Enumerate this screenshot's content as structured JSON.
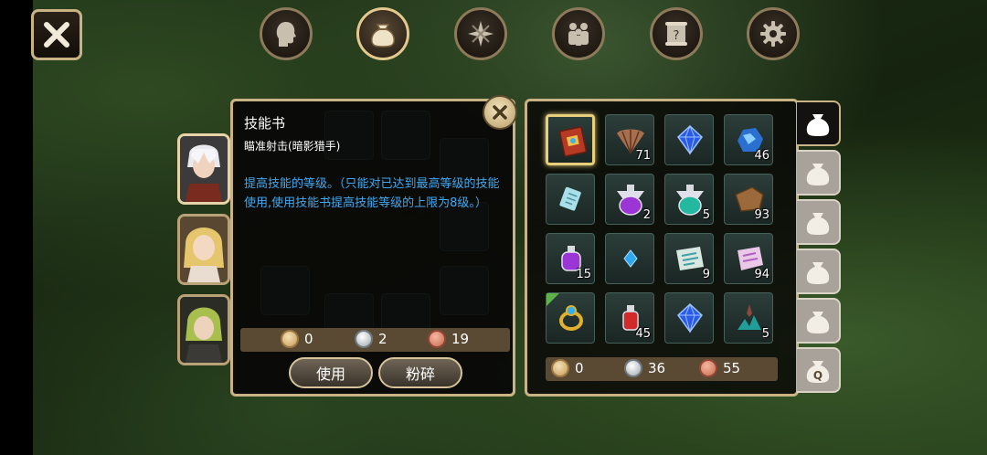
{
  "nav_tabs": [
    {
      "name": "character",
      "icon": "head-icon",
      "active": false
    },
    {
      "name": "bag",
      "icon": "bag-icon",
      "active": true
    },
    {
      "name": "skills",
      "icon": "compass-icon",
      "active": false
    },
    {
      "name": "party",
      "icon": "people-icon",
      "active": false
    },
    {
      "name": "quests",
      "icon": "scroll-icon",
      "active": false
    },
    {
      "name": "settings",
      "icon": "gear-icon",
      "active": false
    }
  ],
  "portraits": [
    {
      "icon": "white-haired-hero-portrait",
      "active": true
    },
    {
      "icon": "blonde-heroine-portrait",
      "active": false
    },
    {
      "icon": "green-haired-hero-portrait",
      "active": false
    }
  ],
  "tooltip": {
    "title": "技能书",
    "subtitle": "瞄准射击(暗影猎手)",
    "description": "提高技能的等级。（只能对已达到最高等级的技能使用,使用技能书提高技能等级的上限为8级。）",
    "price": {
      "gold": "0",
      "silver": "2",
      "copper": "19"
    },
    "use_label": "使用",
    "smash_label": "粉碎"
  },
  "inventory": {
    "items": [
      {
        "name": "skill-book",
        "qty": "",
        "selected": true
      },
      {
        "name": "feather-fan",
        "qty": "71"
      },
      {
        "name": "blue-gem",
        "qty": ""
      },
      {
        "name": "blue-ore",
        "qty": "46"
      },
      {
        "name": "rune-tablet",
        "qty": ""
      },
      {
        "name": "purple-potion",
        "qty": "2"
      },
      {
        "name": "teal-potion",
        "qty": "5"
      },
      {
        "name": "leather-hide",
        "qty": "93"
      },
      {
        "name": "small-purple-potion",
        "qty": "15"
      },
      {
        "name": "small-blue-gem",
        "qty": ""
      },
      {
        "name": "map-scroll",
        "qty": "9"
      },
      {
        "name": "pink-scroll",
        "qty": "94"
      },
      {
        "name": "gold-ring",
        "qty": "",
        "new": true
      },
      {
        "name": "red-potion",
        "qty": "45"
      },
      {
        "name": "blue-gem",
        "qty": ""
      },
      {
        "name": "crystal-plant",
        "qty": "5"
      }
    ],
    "currency": {
      "gold": "0",
      "silver": "36",
      "copper": "55"
    }
  },
  "bag_tabs": [
    {
      "label": "",
      "active": true
    },
    {
      "label": "",
      "active": false
    },
    {
      "label": "",
      "active": false
    },
    {
      "label": "",
      "active": false
    },
    {
      "label": "",
      "active": false
    },
    {
      "label": "Q",
      "active": false
    }
  ]
}
